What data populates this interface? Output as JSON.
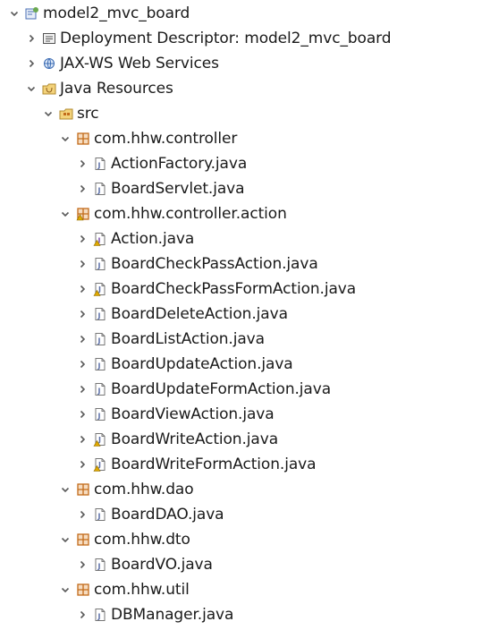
{
  "tree": [
    {
      "name": "project-node",
      "label": "model2_mvc_board",
      "icon": "project-icon",
      "depth": 0,
      "expanded": true
    },
    {
      "name": "deployment-descriptor-node",
      "label": "Deployment Descriptor: model2_mvc_board",
      "icon": "deployment-descriptor-icon",
      "depth": 1,
      "expanded": false
    },
    {
      "name": "jax-ws-node",
      "label": "JAX-WS Web Services",
      "icon": "web-services-icon",
      "depth": 1,
      "expanded": false
    },
    {
      "name": "java-resources-node",
      "label": "Java Resources",
      "icon": "java-resources-icon",
      "depth": 1,
      "expanded": true
    },
    {
      "name": "src-folder-node",
      "label": "src",
      "icon": "source-folder-icon",
      "depth": 2,
      "expanded": true
    },
    {
      "name": "package-controller-node",
      "label": "com.hhw.controller",
      "icon": "package-icon",
      "depth": 3,
      "expanded": true
    },
    {
      "name": "file-actionfactory-node",
      "label": "ActionFactory.java",
      "icon": "java-file-icon",
      "depth": 4,
      "expanded": false
    },
    {
      "name": "file-boardservlet-node",
      "label": "BoardServlet.java",
      "icon": "java-file-icon",
      "depth": 4,
      "expanded": false
    },
    {
      "name": "package-controller-action-node",
      "label": "com.hhw.controller.action",
      "icon": "package-warning-icon",
      "depth": 3,
      "expanded": true
    },
    {
      "name": "file-action-node",
      "label": "Action.java",
      "icon": "java-interface-file-icon",
      "depth": 4,
      "expanded": false
    },
    {
      "name": "file-boardcheckpassaction-node",
      "label": "BoardCheckPassAction.java",
      "icon": "java-file-icon",
      "depth": 4,
      "expanded": false
    },
    {
      "name": "file-boardcheckpassformaction-node",
      "label": "BoardCheckPassFormAction.java",
      "icon": "java-file-warning-icon",
      "depth": 4,
      "expanded": false
    },
    {
      "name": "file-boarddeleteaction-node",
      "label": "BoardDeleteAction.java",
      "icon": "java-file-icon",
      "depth": 4,
      "expanded": false
    },
    {
      "name": "file-boardlistaction-node",
      "label": "BoardListAction.java",
      "icon": "java-file-icon",
      "depth": 4,
      "expanded": false
    },
    {
      "name": "file-boardupdateaction-node",
      "label": "BoardUpdateAction.java",
      "icon": "java-file-icon",
      "depth": 4,
      "expanded": false
    },
    {
      "name": "file-boardupdateformaction-node",
      "label": "BoardUpdateFormAction.java",
      "icon": "java-file-icon",
      "depth": 4,
      "expanded": false
    },
    {
      "name": "file-boardviewaction-node",
      "label": "BoardViewAction.java",
      "icon": "java-file-icon",
      "depth": 4,
      "expanded": false
    },
    {
      "name": "file-boardwriteaction-node",
      "label": "BoardWriteAction.java",
      "icon": "java-file-warning-icon",
      "depth": 4,
      "expanded": false
    },
    {
      "name": "file-boardwriteformaction-node",
      "label": "BoardWriteFormAction.java",
      "icon": "java-file-warning-icon",
      "depth": 4,
      "expanded": false
    },
    {
      "name": "package-dao-node",
      "label": "com.hhw.dao",
      "icon": "package-icon",
      "depth": 3,
      "expanded": true
    },
    {
      "name": "file-boarddao-node",
      "label": "BoardDAO.java",
      "icon": "java-file-icon",
      "depth": 4,
      "expanded": false
    },
    {
      "name": "package-dto-node",
      "label": "com.hhw.dto",
      "icon": "package-icon",
      "depth": 3,
      "expanded": true
    },
    {
      "name": "file-boardvo-node",
      "label": "BoardVO.java",
      "icon": "java-file-icon",
      "depth": 4,
      "expanded": false
    },
    {
      "name": "package-util-node",
      "label": "com.hhw.util",
      "icon": "package-icon",
      "depth": 3,
      "expanded": true
    },
    {
      "name": "file-dbmanager-node",
      "label": "DBManager.java",
      "icon": "java-file-icon",
      "depth": 4,
      "expanded": false
    }
  ],
  "colors": {
    "text": "#1a1a1a",
    "twistie": "#5a5a5a",
    "package": "#c26b1a",
    "java_file": "#5b6fa8",
    "warning": "#e0a800",
    "project": "#4a6fb5"
  }
}
